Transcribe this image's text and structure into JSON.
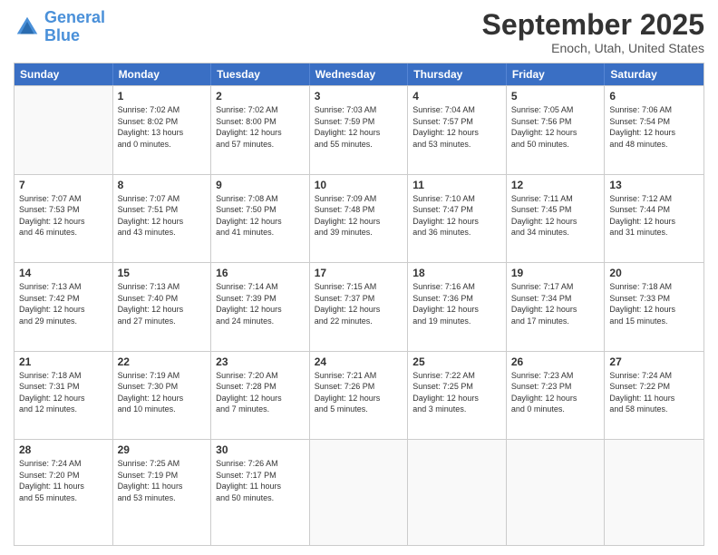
{
  "header": {
    "logo_line1": "General",
    "logo_line2": "Blue",
    "month": "September 2025",
    "location": "Enoch, Utah, United States"
  },
  "weekdays": [
    "Sunday",
    "Monday",
    "Tuesday",
    "Wednesday",
    "Thursday",
    "Friday",
    "Saturday"
  ],
  "rows": [
    [
      {
        "day": "",
        "text": ""
      },
      {
        "day": "1",
        "text": "Sunrise: 7:02 AM\nSunset: 8:02 PM\nDaylight: 13 hours\nand 0 minutes."
      },
      {
        "day": "2",
        "text": "Sunrise: 7:02 AM\nSunset: 8:00 PM\nDaylight: 12 hours\nand 57 minutes."
      },
      {
        "day": "3",
        "text": "Sunrise: 7:03 AM\nSunset: 7:59 PM\nDaylight: 12 hours\nand 55 minutes."
      },
      {
        "day": "4",
        "text": "Sunrise: 7:04 AM\nSunset: 7:57 PM\nDaylight: 12 hours\nand 53 minutes."
      },
      {
        "day": "5",
        "text": "Sunrise: 7:05 AM\nSunset: 7:56 PM\nDaylight: 12 hours\nand 50 minutes."
      },
      {
        "day": "6",
        "text": "Sunrise: 7:06 AM\nSunset: 7:54 PM\nDaylight: 12 hours\nand 48 minutes."
      }
    ],
    [
      {
        "day": "7",
        "text": "Sunrise: 7:07 AM\nSunset: 7:53 PM\nDaylight: 12 hours\nand 46 minutes."
      },
      {
        "day": "8",
        "text": "Sunrise: 7:07 AM\nSunset: 7:51 PM\nDaylight: 12 hours\nand 43 minutes."
      },
      {
        "day": "9",
        "text": "Sunrise: 7:08 AM\nSunset: 7:50 PM\nDaylight: 12 hours\nand 41 minutes."
      },
      {
        "day": "10",
        "text": "Sunrise: 7:09 AM\nSunset: 7:48 PM\nDaylight: 12 hours\nand 39 minutes."
      },
      {
        "day": "11",
        "text": "Sunrise: 7:10 AM\nSunset: 7:47 PM\nDaylight: 12 hours\nand 36 minutes."
      },
      {
        "day": "12",
        "text": "Sunrise: 7:11 AM\nSunset: 7:45 PM\nDaylight: 12 hours\nand 34 minutes."
      },
      {
        "day": "13",
        "text": "Sunrise: 7:12 AM\nSunset: 7:44 PM\nDaylight: 12 hours\nand 31 minutes."
      }
    ],
    [
      {
        "day": "14",
        "text": "Sunrise: 7:13 AM\nSunset: 7:42 PM\nDaylight: 12 hours\nand 29 minutes."
      },
      {
        "day": "15",
        "text": "Sunrise: 7:13 AM\nSunset: 7:40 PM\nDaylight: 12 hours\nand 27 minutes."
      },
      {
        "day": "16",
        "text": "Sunrise: 7:14 AM\nSunset: 7:39 PM\nDaylight: 12 hours\nand 24 minutes."
      },
      {
        "day": "17",
        "text": "Sunrise: 7:15 AM\nSunset: 7:37 PM\nDaylight: 12 hours\nand 22 minutes."
      },
      {
        "day": "18",
        "text": "Sunrise: 7:16 AM\nSunset: 7:36 PM\nDaylight: 12 hours\nand 19 minutes."
      },
      {
        "day": "19",
        "text": "Sunrise: 7:17 AM\nSunset: 7:34 PM\nDaylight: 12 hours\nand 17 minutes."
      },
      {
        "day": "20",
        "text": "Sunrise: 7:18 AM\nSunset: 7:33 PM\nDaylight: 12 hours\nand 15 minutes."
      }
    ],
    [
      {
        "day": "21",
        "text": "Sunrise: 7:18 AM\nSunset: 7:31 PM\nDaylight: 12 hours\nand 12 minutes."
      },
      {
        "day": "22",
        "text": "Sunrise: 7:19 AM\nSunset: 7:30 PM\nDaylight: 12 hours\nand 10 minutes."
      },
      {
        "day": "23",
        "text": "Sunrise: 7:20 AM\nSunset: 7:28 PM\nDaylight: 12 hours\nand 7 minutes."
      },
      {
        "day": "24",
        "text": "Sunrise: 7:21 AM\nSunset: 7:26 PM\nDaylight: 12 hours\nand 5 minutes."
      },
      {
        "day": "25",
        "text": "Sunrise: 7:22 AM\nSunset: 7:25 PM\nDaylight: 12 hours\nand 3 minutes."
      },
      {
        "day": "26",
        "text": "Sunrise: 7:23 AM\nSunset: 7:23 PM\nDaylight: 12 hours\nand 0 minutes."
      },
      {
        "day": "27",
        "text": "Sunrise: 7:24 AM\nSunset: 7:22 PM\nDaylight: 11 hours\nand 58 minutes."
      }
    ],
    [
      {
        "day": "28",
        "text": "Sunrise: 7:24 AM\nSunset: 7:20 PM\nDaylight: 11 hours\nand 55 minutes."
      },
      {
        "day": "29",
        "text": "Sunrise: 7:25 AM\nSunset: 7:19 PM\nDaylight: 11 hours\nand 53 minutes."
      },
      {
        "day": "30",
        "text": "Sunrise: 7:26 AM\nSunset: 7:17 PM\nDaylight: 11 hours\nand 50 minutes."
      },
      {
        "day": "",
        "text": ""
      },
      {
        "day": "",
        "text": ""
      },
      {
        "day": "",
        "text": ""
      },
      {
        "day": "",
        "text": ""
      }
    ]
  ]
}
